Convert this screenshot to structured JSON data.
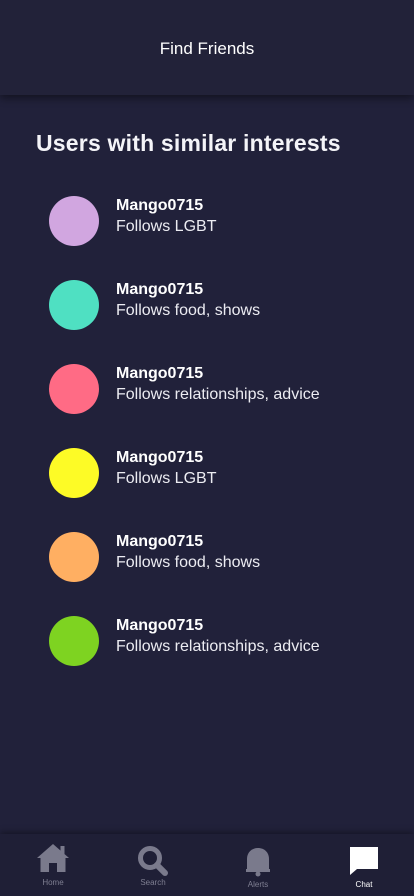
{
  "header": {
    "title": "Find Friends"
  },
  "section": {
    "title": "Users with similar interests"
  },
  "users": [
    {
      "name": "Mango0715",
      "follows": "Follows LGBT",
      "avatar_color": "#d1a6e0"
    },
    {
      "name": "Mango0715",
      "follows": "Follows food, shows",
      "avatar_color": "#4fe0c2"
    },
    {
      "name": "Mango0715",
      "follows": "Follows relationships, advice",
      "avatar_color": "#ff6b85"
    },
    {
      "name": "Mango0715",
      "follows": "Follows LGBT",
      "avatar_color": "#fdfb26"
    },
    {
      "name": "Mango0715",
      "follows": "Follows food, shows",
      "avatar_color": "#ffaf62"
    },
    {
      "name": "Mango0715",
      "follows": "Follows relationships, advice",
      "avatar_color": "#7ed321"
    }
  ],
  "tabbar": {
    "items": [
      {
        "label": "Home",
        "icon": "home-icon"
      },
      {
        "label": "Search",
        "icon": "search-icon"
      },
      {
        "label": "Alerts",
        "icon": "bell-icon"
      },
      {
        "label": "Chat",
        "icon": "chat-icon",
        "active": true
      }
    ]
  },
  "colors": {
    "background": "#21213a",
    "icon_inactive": "#7a7a8c",
    "icon_active": "#ffffff"
  }
}
